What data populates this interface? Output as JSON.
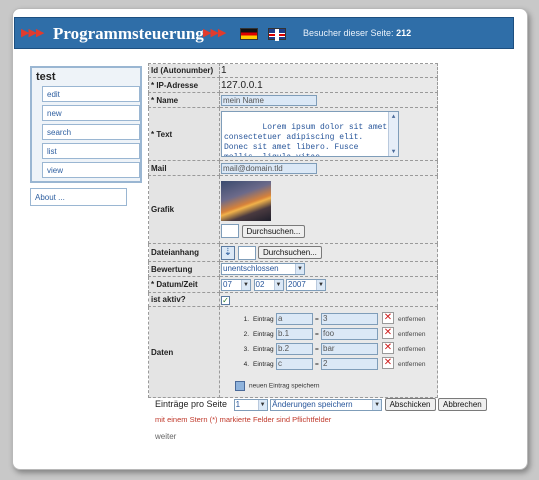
{
  "header": {
    "arrows_left": "▶▶▶",
    "title": "Programmsteuerung",
    "arrows_right": "▶▶▶",
    "visitors_label": "Besucher dieser Seite:",
    "visitors_count": "212"
  },
  "sidebar": {
    "title": "test",
    "items": [
      {
        "label": "edit"
      },
      {
        "label": "new"
      },
      {
        "label": "search"
      },
      {
        "label": "list"
      },
      {
        "label": "view"
      }
    ],
    "about_label": "About ..."
  },
  "form": {
    "rows": {
      "id": {
        "label": "Id (Autonumber)",
        "value": "1"
      },
      "ip": {
        "label": "* IP-Adresse",
        "value": "127.0.0.1"
      },
      "name": {
        "label": "* Name",
        "value": "mein Name"
      },
      "text": {
        "label": "* Text",
        "value": "Lorem ipsum dolor sit amet,\nconsectetuer adipiscing elit.\nDonec sit amet libero. Fusce\nmollis, ligula vitae"
      },
      "mail": {
        "label": "Mail",
        "value": "mail@domain.tld"
      },
      "grafik": {
        "label": "Grafik",
        "browse_label": "Durchsuchen..."
      },
      "dateianhang": {
        "label": "Dateianhang",
        "browse_label": "Durchsuchen..."
      },
      "bewertung": {
        "label": "Bewertung",
        "selected": "unentschlossen"
      },
      "datum": {
        "label": "* Datum/Zeit",
        "day": "07",
        "month": "02",
        "year": "2007"
      },
      "aktiv": {
        "label": "ist aktiv?",
        "checked": true,
        "mark": "✓"
      },
      "daten": {
        "label": "Daten",
        "entry_word": "Eintrag",
        "remove_label": "entfernen",
        "entries": [
          {
            "index": "1.",
            "key": "a",
            "value": "3"
          },
          {
            "index": "2.",
            "key": "b.1",
            "value": "foo"
          },
          {
            "index": "3.",
            "key": "b.2",
            "value": "bar"
          },
          {
            "index": "4.",
            "key": "c",
            "value": "2"
          }
        ],
        "save_entry_label": "neuen Eintrag speichern"
      }
    }
  },
  "footer": {
    "per_page_label": "Einträge pro Seite",
    "per_page_value": "1",
    "action_selected": "Änderungen speichern",
    "submit_label": "Abschicken",
    "cancel_label": "Abbrechen",
    "required_note": "mit einem Stern (*) markierte Felder sind Pflichtfelder",
    "weiter_label": "weiter"
  },
  "colors": {
    "header_bg": "#2f6ea8",
    "accent_arrows": "#e23b2d",
    "link": "#2e5fa0",
    "required_note": "#c0392b"
  }
}
